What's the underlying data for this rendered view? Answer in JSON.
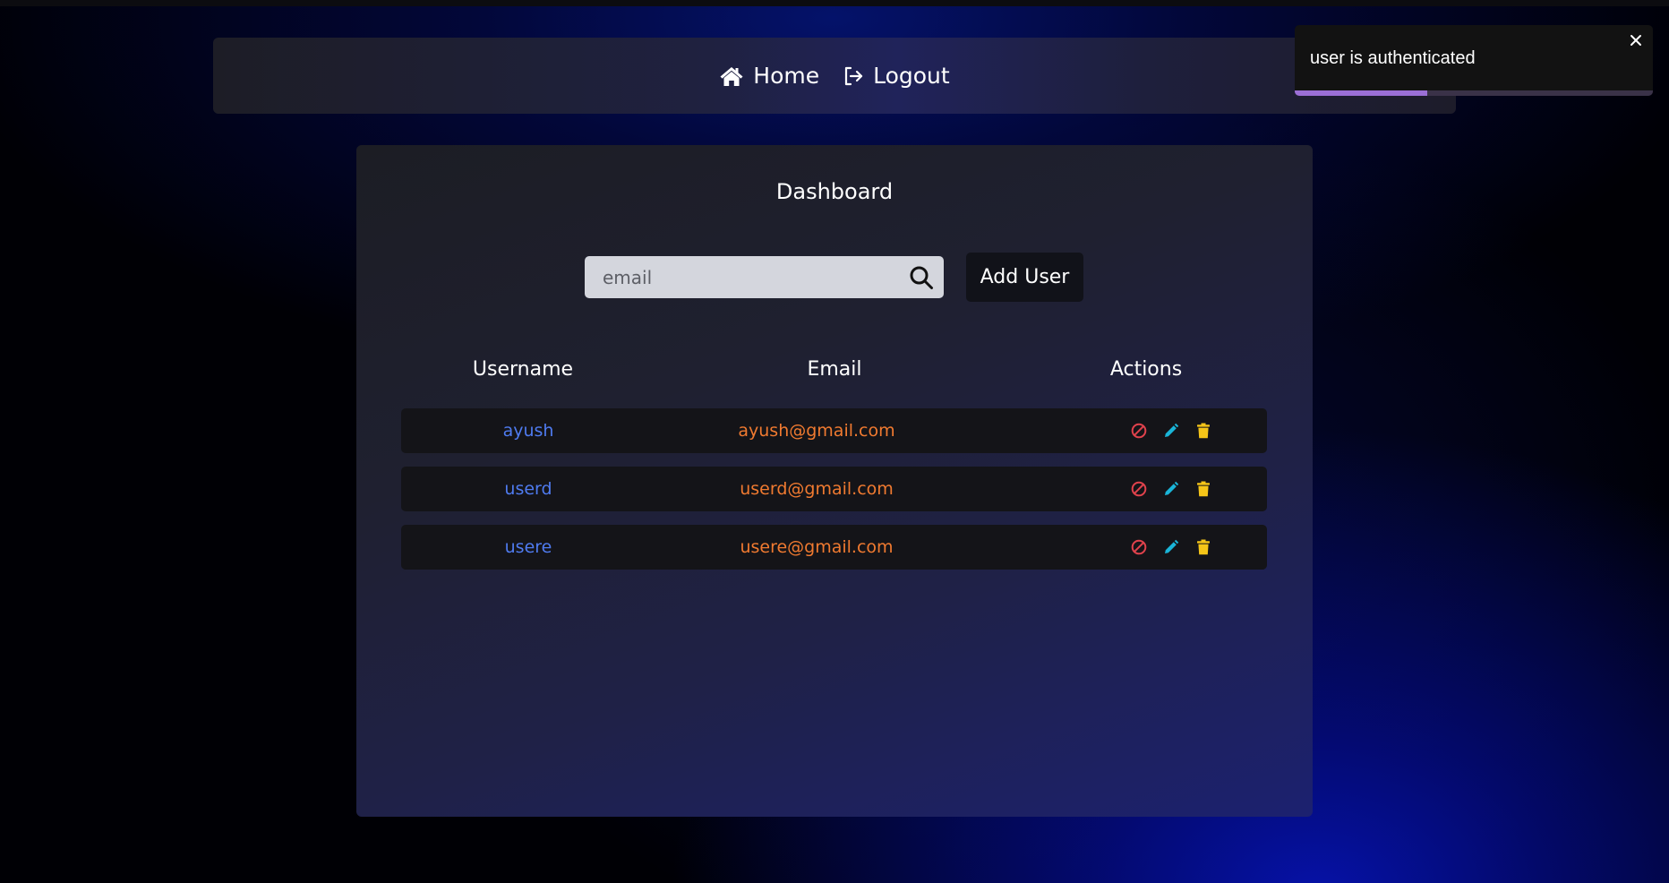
{
  "nav": {
    "home_label": "Home",
    "logout_label": "Logout"
  },
  "dashboard": {
    "title": "Dashboard",
    "search": {
      "placeholder": "email",
      "value": ""
    },
    "add_user_label": "Add User",
    "columns": [
      "Username",
      "Email",
      "Actions"
    ],
    "rows": [
      {
        "username": "ayush",
        "email": "ayush@gmail.com"
      },
      {
        "username": "userd",
        "email": "userd@gmail.com"
      },
      {
        "username": "usere",
        "email": "usere@gmail.com"
      }
    ],
    "row_actions": [
      "block-icon",
      "edit-icon",
      "delete-icon"
    ]
  },
  "toast": {
    "message": "user is authenticated",
    "progress": 0.37
  },
  "colors": {
    "username": "#4f7bf0",
    "email": "#f07a30",
    "block": "#e0424c",
    "edit": "#1ab5d8",
    "delete": "#f5c518",
    "toast_progress": "#9b6fd6"
  }
}
